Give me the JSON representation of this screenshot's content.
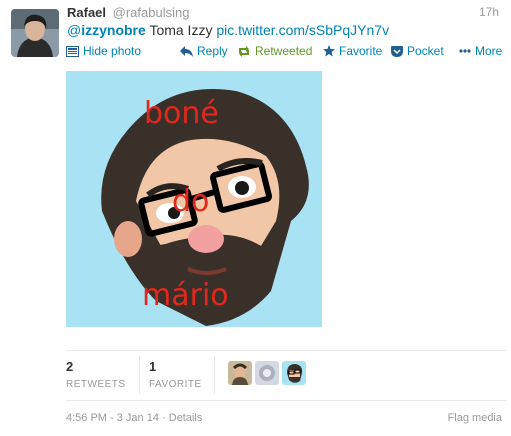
{
  "tweet": {
    "name": "Rafael",
    "handle": "@rafabulsing",
    "time": "17h",
    "mention_prefix": "@",
    "mention_user": "izzynobre",
    "text": "Toma Izzy",
    "link": "pic.twitter.com/sSbPqJYn7v"
  },
  "actions": {
    "hide_photo": "Hide photo",
    "reply": "Reply",
    "retweeted": "Retweeted",
    "favorite": "Favorite",
    "pocket": "Pocket",
    "more": "More"
  },
  "image_text": {
    "line1": "boné",
    "line2": "do",
    "line3": "mário"
  },
  "stats": {
    "retweets_count": "2",
    "retweets_label": "RETWEETS",
    "favorites_count": "1",
    "favorites_label": "FAVORITE"
  },
  "footer": {
    "timestamp": "4:56 PM - 3 Jan 14",
    "separator": "·",
    "details": "Details",
    "flag": "Flag media"
  },
  "colors": {
    "link": "#0084b4",
    "retweeted": "#609928",
    "muted": "#999999",
    "photo_bg": "#a9e3f3",
    "annotation_red": "#e0281e"
  }
}
